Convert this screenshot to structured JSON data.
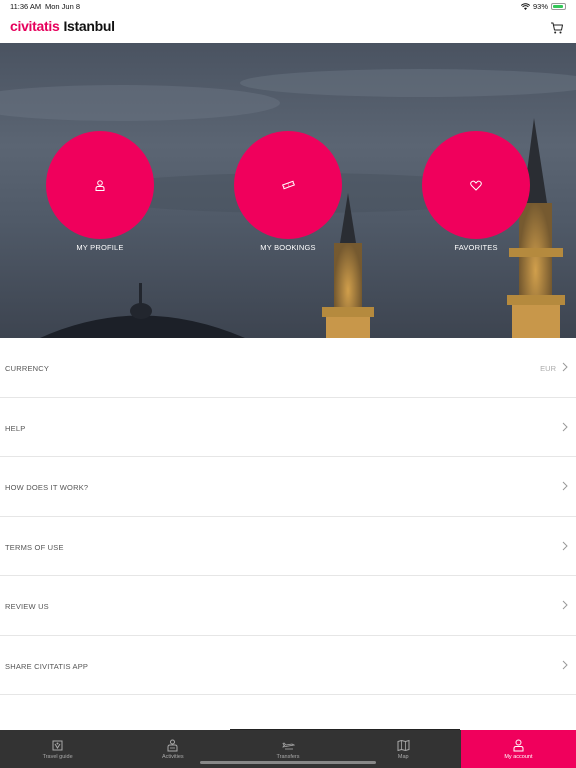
{
  "status_bar": {
    "time": "11:36 AM",
    "date": "Mon Jun 8",
    "battery": "93%",
    "battery_level": 0.93
  },
  "header": {
    "brand": "civitatis",
    "city": "Istanbul",
    "cart_icon": "cart-icon"
  },
  "hero": {
    "actions": [
      {
        "label": "MY PROFILE",
        "icon": "user-icon"
      },
      {
        "label": "MY BOOKINGS",
        "icon": "ticket-icon"
      },
      {
        "label": "FAVORITES",
        "icon": "heart-icon"
      }
    ]
  },
  "menu": {
    "items": [
      {
        "label": "CURRENCY",
        "value": "EUR"
      },
      {
        "label": "HELP",
        "value": ""
      },
      {
        "label": "HOW DOES IT WORK?",
        "value": ""
      },
      {
        "label": "TERMS OF USE",
        "value": ""
      },
      {
        "label": "REVIEW US",
        "value": ""
      },
      {
        "label": "SHARE CIVITATIS APP",
        "value": ""
      }
    ]
  },
  "tabs": [
    {
      "label": "Travel guide",
      "icon": "book-map-icon",
      "active": false
    },
    {
      "label": "Activities",
      "icon": "activities-icon",
      "active": false
    },
    {
      "label": "Transfers",
      "icon": "plane-icon",
      "active": false
    },
    {
      "label": "Map",
      "icon": "map-icon",
      "active": false
    },
    {
      "label": "My account",
      "icon": "user-icon",
      "active": true
    }
  ],
  "colors": {
    "brand": "#e6005c",
    "accent": "#f0005c",
    "tab_bar": "#333333"
  }
}
